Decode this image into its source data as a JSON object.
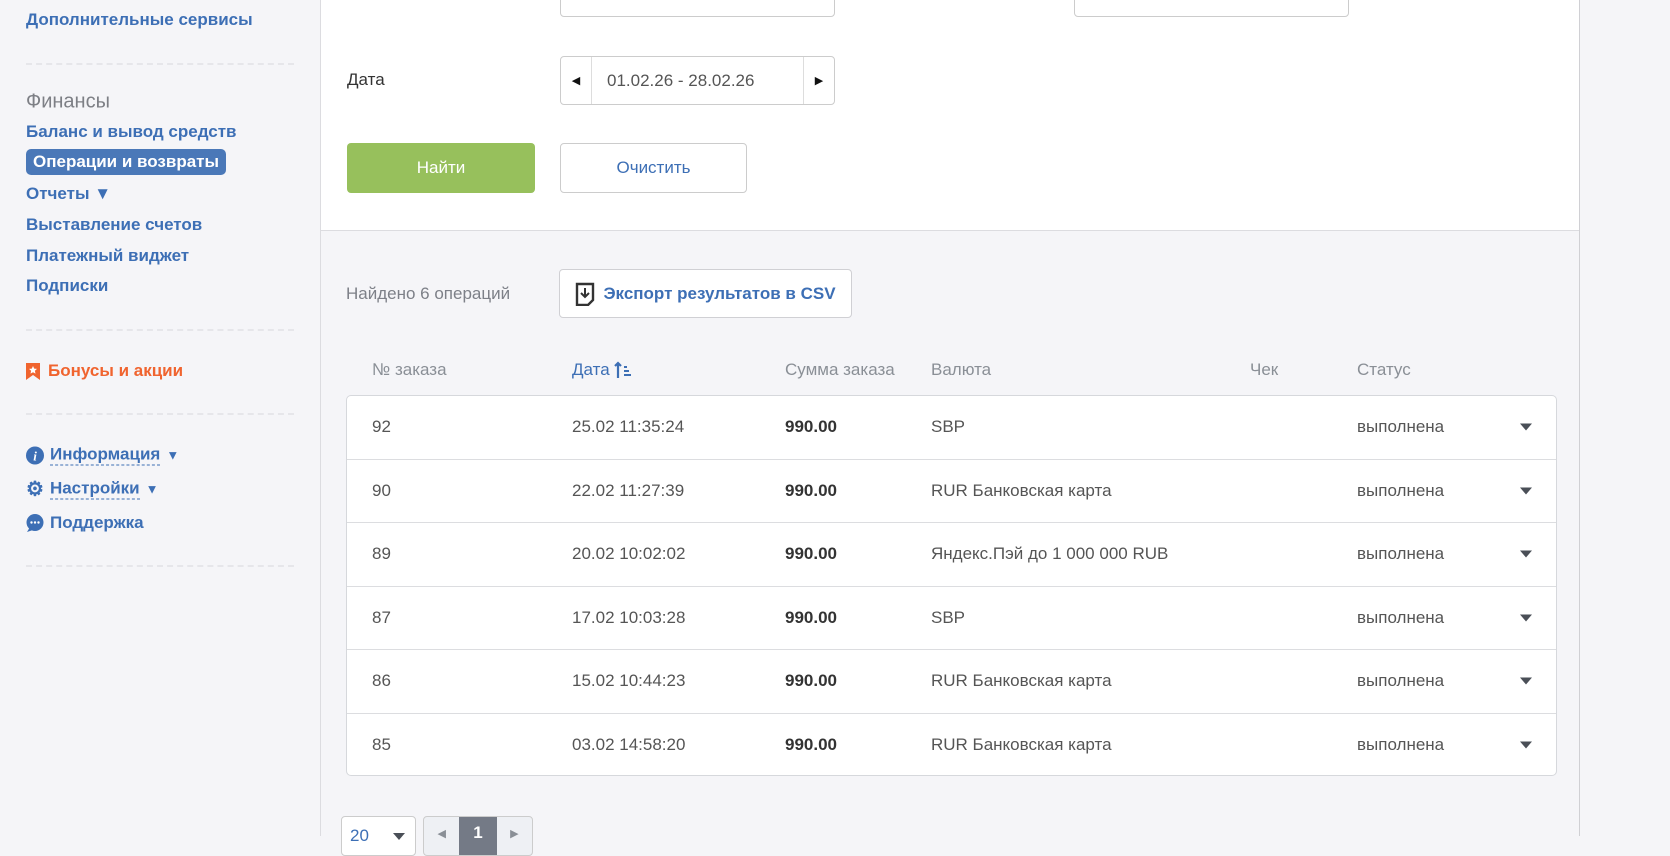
{
  "sidebar": {
    "extra_services": "Дополнительные сервисы",
    "finance_heading": "Финансы",
    "finance_items": [
      "Баланс и вывод средств",
      "Операции и возвраты",
      "Отчеты ▼",
      "Выставление счетов",
      "Платежный виджет",
      "Подписки"
    ],
    "bonuses": "Бонусы и акции",
    "info": "Информация",
    "settings": "Настройки",
    "support": "Поддержка"
  },
  "form": {
    "date_label": "Дата",
    "date_value": "01.02.26 - 28.02.26",
    "find_label": "Найти",
    "clear_label": "Очистить"
  },
  "results": {
    "found_text": "Найдено 6 операций",
    "export_label": "Экспорт результатов в CSV",
    "columns": [
      "№ заказа",
      "Дата",
      "Сумма заказа",
      "Валюта",
      "Чек",
      "Статус"
    ],
    "rows": [
      {
        "id": "92",
        "date": "25.02 11:35:24",
        "amount": "990.00",
        "currency": "SBP",
        "status": "выполнена"
      },
      {
        "id": "90",
        "date": "22.02 11:27:39",
        "amount": "990.00",
        "currency": "RUR Банковская карта",
        "status": "выполнена"
      },
      {
        "id": "89",
        "date": "20.02 10:02:02",
        "amount": "990.00",
        "currency": "Яндекс.Пэй до 1 000 000 RUB",
        "status": "выполнена"
      },
      {
        "id": "87",
        "date": "17.02 10:03:28",
        "amount": "990.00",
        "currency": "SBP",
        "status": "выполнена"
      },
      {
        "id": "86",
        "date": "15.02 10:44:23",
        "amount": "990.00",
        "currency": "RUR Банковская карта",
        "status": "выполнена"
      },
      {
        "id": "85",
        "date": "03.02 14:58:20",
        "amount": "990.00",
        "currency": "RUR Банковская карта",
        "status": "выполнена"
      }
    ]
  },
  "pagination": {
    "page_size": "20",
    "current_page": "1"
  },
  "colors": {
    "accent": "#3d6fb5",
    "find": "#97c05c",
    "bonus": "#f0642f"
  }
}
